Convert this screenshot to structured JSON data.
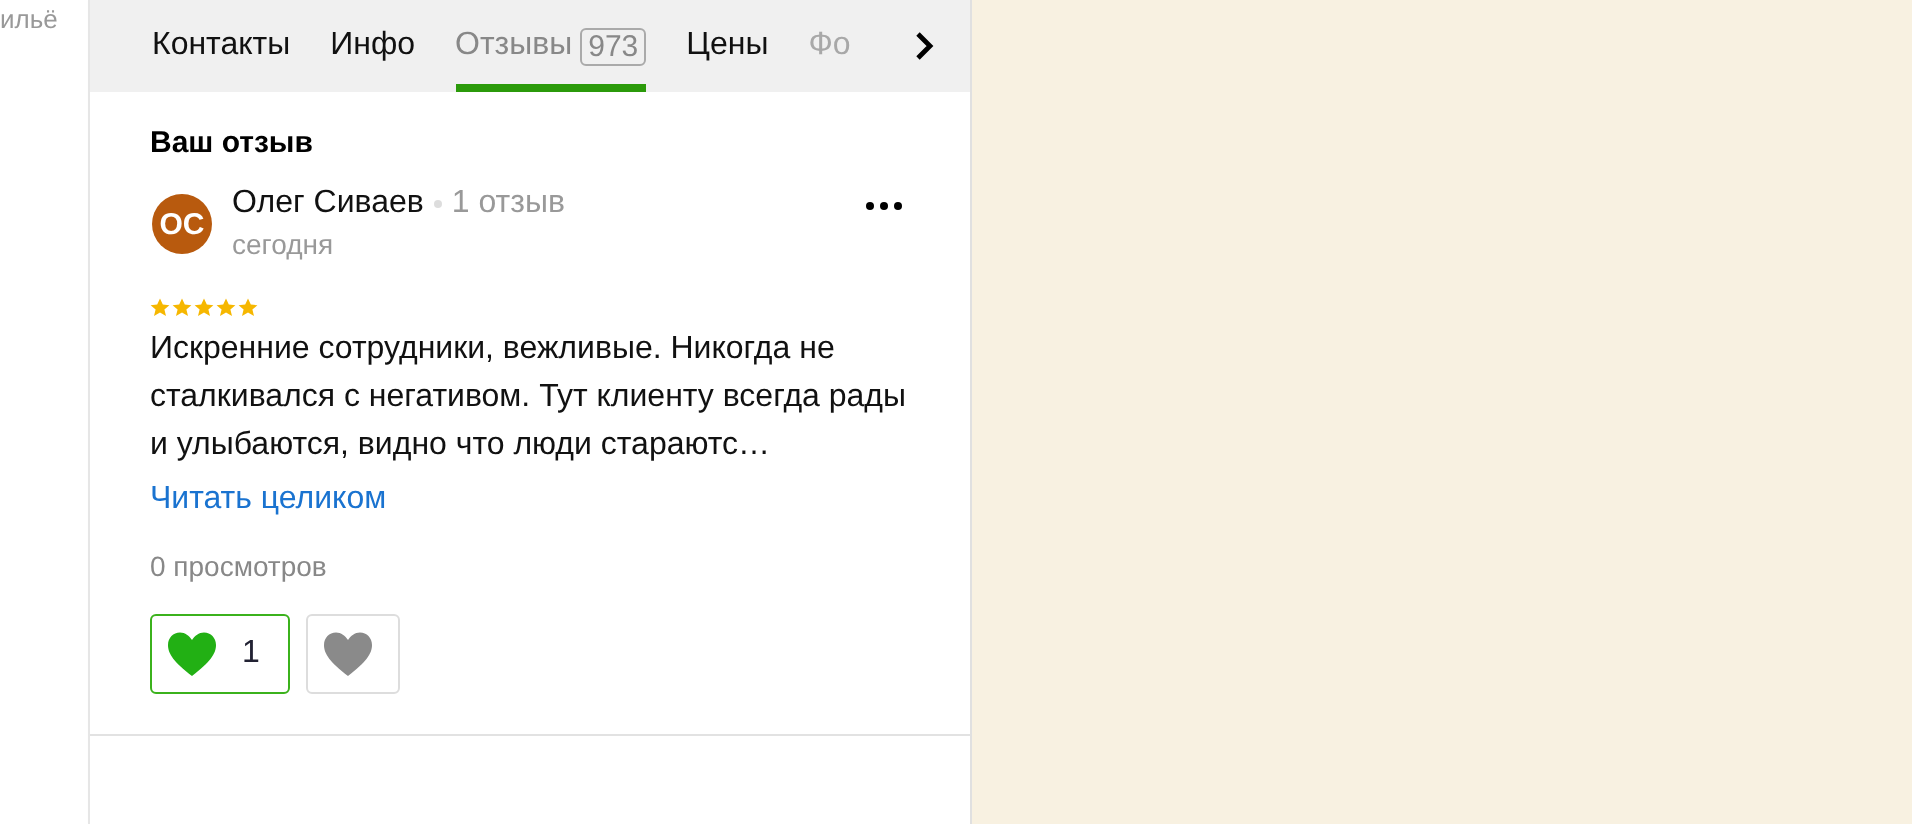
{
  "side_text": "ильё",
  "tabs": [
    {
      "label": "Контакты",
      "selected": false,
      "faded": false
    },
    {
      "label": "Инфо",
      "selected": false,
      "faded": false
    },
    {
      "label": "Отзывы",
      "count": "973",
      "selected": true,
      "faded": false
    },
    {
      "label": "Цены",
      "selected": false,
      "faded": false
    },
    {
      "label": "Фо",
      "selected": false,
      "faded": true
    }
  ],
  "section_title": "Ваш отзыв",
  "review": {
    "avatar_initials": "ОС",
    "author": "Олег Сиваев",
    "author_reviews": "1 отзыв",
    "date": "сегодня",
    "stars": 5,
    "text": "Искренние сотрудники, вежливые. Никогда не сталкивался с негативом. Тут клиенту всегда рады и улыбаются, видно что люди стараютс…",
    "read_more": "Читать целиком",
    "views": "0 просмотров",
    "reactions": [
      {
        "kind": "like",
        "count": "1",
        "selected": true
      },
      {
        "kind": "dislike",
        "selected": false
      }
    ]
  }
}
